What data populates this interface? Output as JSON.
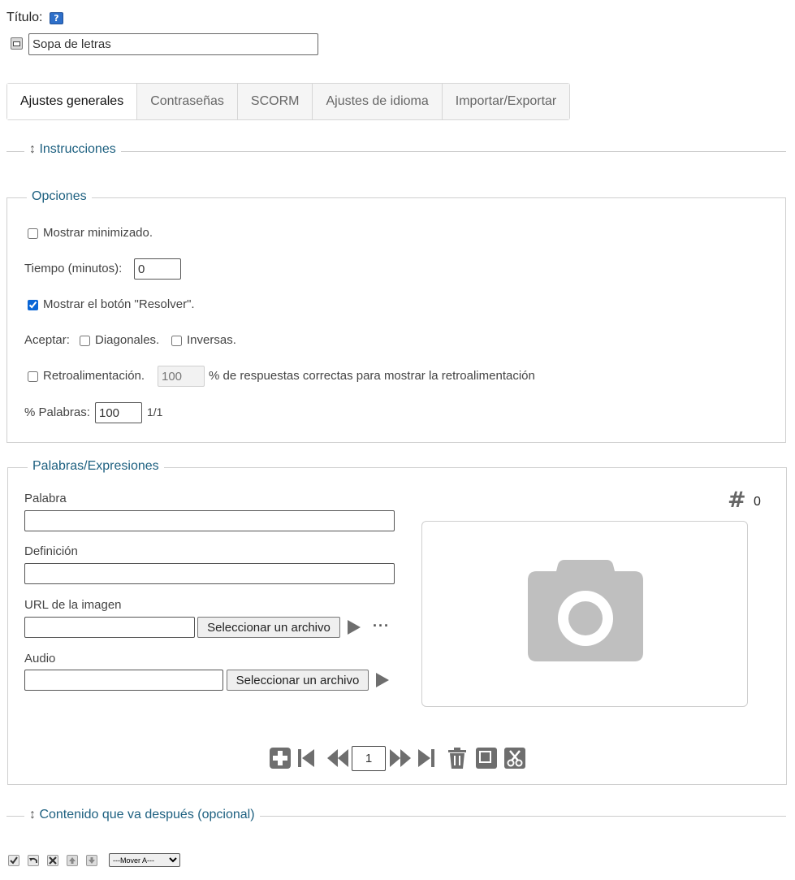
{
  "title": {
    "label": "Título:",
    "value": "Sopa de letras"
  },
  "tabs": [
    {
      "label": "Ajustes generales",
      "active": true
    },
    {
      "label": "Contraseñas",
      "active": false
    },
    {
      "label": "SCORM",
      "active": false
    },
    {
      "label": "Ajustes de idioma",
      "active": false
    },
    {
      "label": "Importar/Exportar",
      "active": false
    }
  ],
  "instructions": {
    "toggle_glyph": "↕",
    "label": "Instrucciones"
  },
  "options": {
    "legend": "Opciones",
    "show_minimized": {
      "label": "Mostrar minimizado.",
      "checked": false
    },
    "time": {
      "label": "Tiempo (minutos):",
      "value": "0"
    },
    "show_solve": {
      "label": "Mostrar el botón \"Resolver\".",
      "checked": true
    },
    "accept": {
      "label": "Aceptar:",
      "diagonals": {
        "label": "Diagonales.",
        "checked": false
      },
      "inverse": {
        "label": "Inversas.",
        "checked": false
      }
    },
    "feedback": {
      "label": "Retroalimentación.",
      "checked": false,
      "value": "100",
      "suffix": "% de respuestas correctas para mostrar la retroalimentación"
    },
    "words_percent": {
      "label": "% Palabras:",
      "value": "100",
      "ratio": "1/1"
    }
  },
  "words": {
    "legend": "Palabras/Expresiones",
    "word": {
      "label": "Palabra",
      "value": ""
    },
    "definition": {
      "label": "Definición",
      "value": ""
    },
    "image_url": {
      "label": "URL de la imagen",
      "value": "",
      "select_button": "Seleccionar un archivo",
      "more_glyph": "···"
    },
    "audio": {
      "label": "Audio",
      "value": "",
      "select_button": "Seleccionar un archivo"
    },
    "counter": {
      "glyph": "#",
      "value": "0"
    },
    "image_placeholder_icon": "camera-icon",
    "pager": {
      "value": "1"
    }
  },
  "after_content": {
    "toggle_glyph": "↕",
    "label": "Contenido que va después (opcional)"
  },
  "toolbar": {
    "move_select": {
      "selected": "---Mover A---"
    }
  },
  "colors": {
    "accent_text": "#1d6080",
    "icon_gray": "#6e6e6e",
    "checkbox_blue": "#0a66d6"
  }
}
